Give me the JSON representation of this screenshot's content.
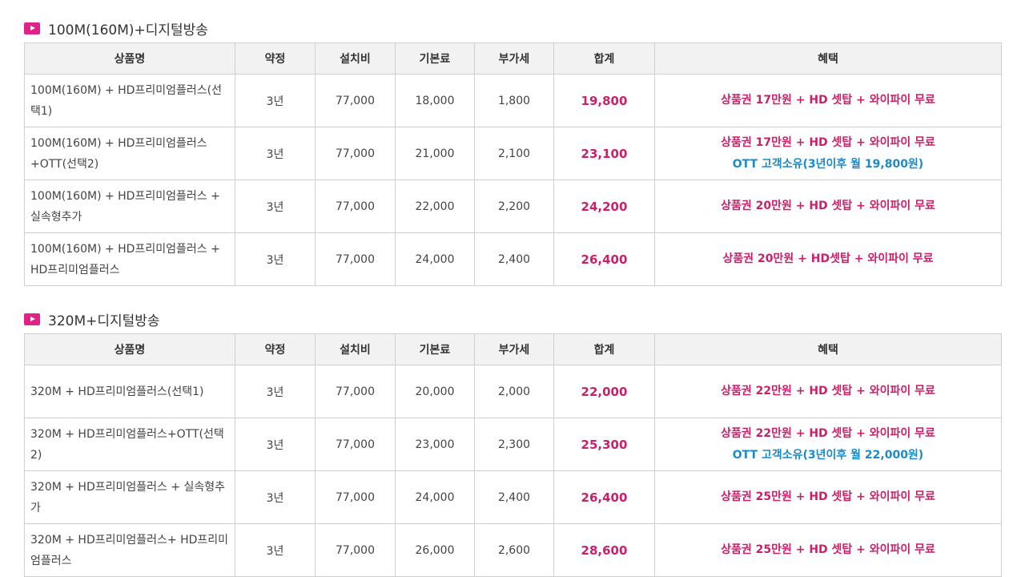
{
  "colors": {
    "accent_pink": "#cc1f6a",
    "accent_blue": "#1a8bc9",
    "header_bg": "#f2f2f2",
    "icon_pink": "#e0218a"
  },
  "headers": [
    "상품명",
    "약정",
    "설치비",
    "기본료",
    "부가세",
    "합계",
    "혜택"
  ],
  "sections": [
    {
      "title": "100M(160M)+디지털방송",
      "rows": [
        {
          "name": "100M(160M) + HD프리미엄플러스(선택1)",
          "term": "3년",
          "install": "77,000",
          "base": "18,000",
          "vat": "1,800",
          "total": "19,800",
          "benefit1": "상품권 17만원 + HD 셋탑 + 와이파이 무료",
          "benefit2": ""
        },
        {
          "name": "100M(160M) + HD프리미엄플러스+OTT(선택2)",
          "term": "3년",
          "install": "77,000",
          "base": "21,000",
          "vat": "2,100",
          "total": "23,100",
          "benefit1": "상품권 17만원 + HD 셋탑 + 와이파이 무료",
          "benefit2": "OTT 고객소유(3년이후 월 19,800원)"
        },
        {
          "name": "100M(160M) + HD프리미엄플러스 + 실속형추가",
          "term": "3년",
          "install": "77,000",
          "base": "22,000",
          "vat": "2,200",
          "total": "24,200",
          "benefit1": "상품권 20만원 + HD 셋탑 + 와이파이 무료",
          "benefit2": ""
        },
        {
          "name": "100M(160M) + HD프리미엄플러스 + HD프리미엄플러스",
          "term": "3년",
          "install": "77,000",
          "base": "24,000",
          "vat": "2,400",
          "total": "26,400",
          "benefit1": "상품권 20만원 + HD셋탑 + 와이파이 무료",
          "benefit2": ""
        }
      ]
    },
    {
      "title": "320M+디지털방송",
      "rows": [
        {
          "name": "320M + HD프리미엄플러스(선택1)",
          "term": "3년",
          "install": "77,000",
          "base": "20,000",
          "vat": "2,000",
          "total": "22,000",
          "benefit1": "상품권 22만원 + HD 셋탑 + 와이파이 무료",
          "benefit2": ""
        },
        {
          "name": "320M + HD프리미엄플러스+OTT(선택2)",
          "term": "3년",
          "install": "77,000",
          "base": "23,000",
          "vat": "2,300",
          "total": "25,300",
          "benefit1": "상품권 22만원 + HD 셋탑 + 와이파이 무료",
          "benefit2": "OTT 고객소유(3년이후 월 22,000원)"
        },
        {
          "name": "320M + HD프리미엄플러스 + 실속형추가",
          "term": "3년",
          "install": "77,000",
          "base": "24,000",
          "vat": "2,400",
          "total": "26,400",
          "benefit1": "상품권 25만원 + HD 셋탑 + 와이파이 무료",
          "benefit2": ""
        },
        {
          "name": "320M + HD프리미엄플러스+ HD프리미엄플러스",
          "term": "3년",
          "install": "77,000",
          "base": "26,000",
          "vat": "2,600",
          "total": "28,600",
          "benefit1": "상품권 25만원 + HD 셋탑 + 와이파이 무료",
          "benefit2": ""
        }
      ]
    }
  ]
}
